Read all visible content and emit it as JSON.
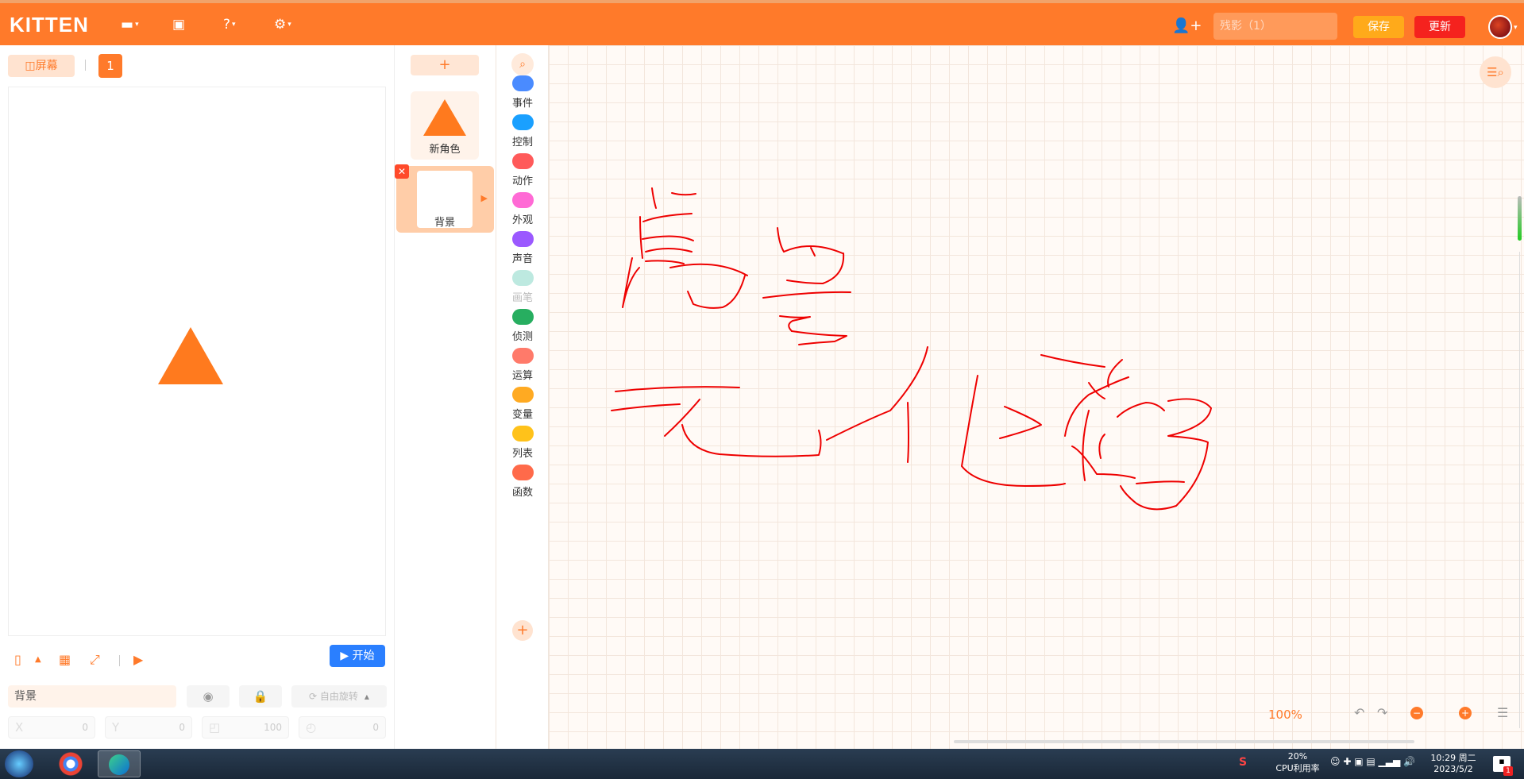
{
  "header": {
    "logo": "KITTEN",
    "project_name": "残影（1）",
    "save_label": "保存",
    "update_label": "更新"
  },
  "left": {
    "screen_label": "屏幕",
    "screen_number": "1",
    "start_label": "开始",
    "object_name": "背景",
    "rotate_label": "自由旋转",
    "x_label": "X",
    "x_value": "0",
    "y_label": "Y",
    "y_value": "0",
    "size_value": "100",
    "rotation_value": "0"
  },
  "sprites": {
    "add_label": "+",
    "items": [
      {
        "label": "新角色"
      },
      {
        "label": "背景"
      }
    ]
  },
  "categories": [
    {
      "label": "事件",
      "color": "#4a8bff",
      "icon": "event-icon"
    },
    {
      "label": "控制",
      "color": "#1aa0ff",
      "icon": "control-icon"
    },
    {
      "label": "动作",
      "color": "#ff5a5a",
      "icon": "motion-icon"
    },
    {
      "label": "外观",
      "color": "#ff6ad5",
      "icon": "looks-icon"
    },
    {
      "label": "声音",
      "color": "#9b59ff",
      "icon": "sound-icon"
    },
    {
      "label": "画笔",
      "color": "#bde9e0",
      "icon": "pen-icon"
    },
    {
      "label": "侦测",
      "color": "#27ae60",
      "icon": "sensing-icon"
    },
    {
      "label": "运算",
      "color": "#ff7a6a",
      "icon": "operator-icon"
    },
    {
      "label": "变量",
      "color": "#ffaa22",
      "icon": "variable-icon"
    },
    {
      "label": "列表",
      "color": "#ffc21a",
      "icon": "list-icon"
    },
    {
      "label": "函数",
      "color": "#ff6a4a",
      "icon": "function-icon"
    }
  ],
  "workspace": {
    "zoom": "100%"
  },
  "taskbar": {
    "cpu_percent": "20%",
    "cpu_label": "CPU利用率",
    "time": "10:29 周二",
    "date": "2023/5/2",
    "notification_count": "1"
  }
}
